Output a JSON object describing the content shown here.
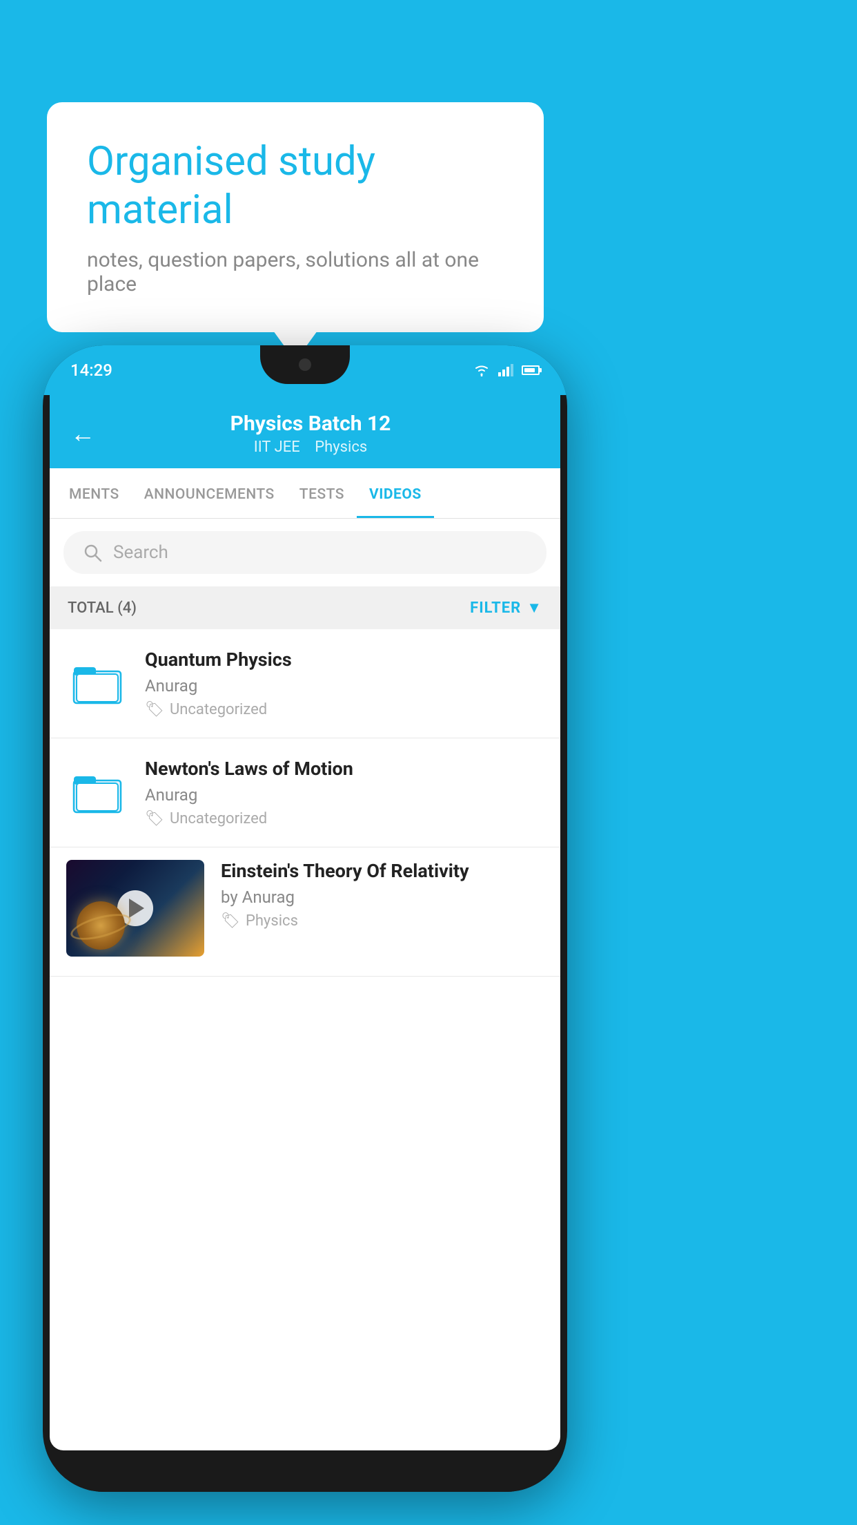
{
  "background_color": "#1ab8e8",
  "speech_bubble": {
    "title": "Organised study material",
    "subtitle": "notes, question papers, solutions all at one place"
  },
  "phone": {
    "status_bar": {
      "time": "14:29"
    },
    "header": {
      "back_label": "←",
      "title": "Physics Batch 12",
      "tag1": "IIT JEE",
      "tag2": "Physics"
    },
    "tabs": [
      {
        "label": "MENTS",
        "active": false
      },
      {
        "label": "ANNOUNCEMENTS",
        "active": false
      },
      {
        "label": "TESTS",
        "active": false
      },
      {
        "label": "VIDEOS",
        "active": true
      }
    ],
    "search": {
      "placeholder": "Search"
    },
    "filter_bar": {
      "total_label": "TOTAL (4)",
      "filter_label": "FILTER"
    },
    "video_items": [
      {
        "title": "Quantum Physics",
        "author": "Anurag",
        "tag": "Uncategorized",
        "has_thumbnail": false
      },
      {
        "title": "Newton's Laws of Motion",
        "author": "Anurag",
        "tag": "Uncategorized",
        "has_thumbnail": false
      },
      {
        "title": "Einstein's Theory Of Relativity",
        "author": "by Anurag",
        "tag": "Physics",
        "has_thumbnail": true
      }
    ]
  }
}
